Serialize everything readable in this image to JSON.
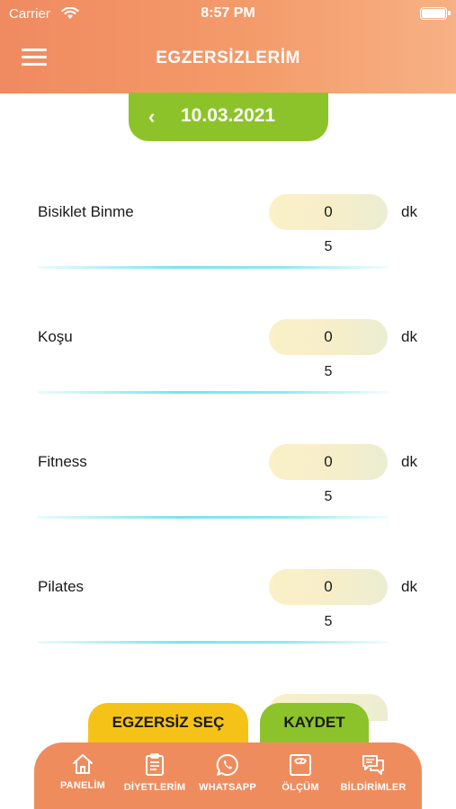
{
  "status_bar": {
    "carrier": "Carrier",
    "time": "8:57 PM"
  },
  "header": {
    "title": "EGZERSİZLERİM"
  },
  "date_nav": {
    "back_symbol": "‹",
    "date": "10.03.2021"
  },
  "exercises": [
    {
      "name": "Bisiklet Binme",
      "minutes": "0",
      "unit": "dk",
      "step": "5"
    },
    {
      "name": "Koşu",
      "minutes": "0",
      "unit": "dk",
      "step": "5"
    },
    {
      "name": "Fitness",
      "minutes": "0",
      "unit": "dk",
      "step": "5"
    },
    {
      "name": "Pilates",
      "minutes": "0",
      "unit": "dk",
      "step": "5"
    }
  ],
  "actions": {
    "select_label": "EGZERSİZ SEÇ",
    "save_label": "KAYDET"
  },
  "tabbar": [
    {
      "label": "PANELİM",
      "icon": "home-icon"
    },
    {
      "label": "DİYETLERİM",
      "icon": "clipboard-icon"
    },
    {
      "label": "WHATSAPP",
      "icon": "whatsapp-icon"
    },
    {
      "label": "ÖLÇÜM",
      "icon": "scale-icon"
    },
    {
      "label": "BİLDİRİMLER",
      "icon": "chat-icon"
    }
  ],
  "colors": {
    "header": "#f08a60",
    "green": "#8dc32a",
    "yellow": "#f5c318",
    "tabbar": "#ef8c5e",
    "divider": "#7ae4ee"
  }
}
